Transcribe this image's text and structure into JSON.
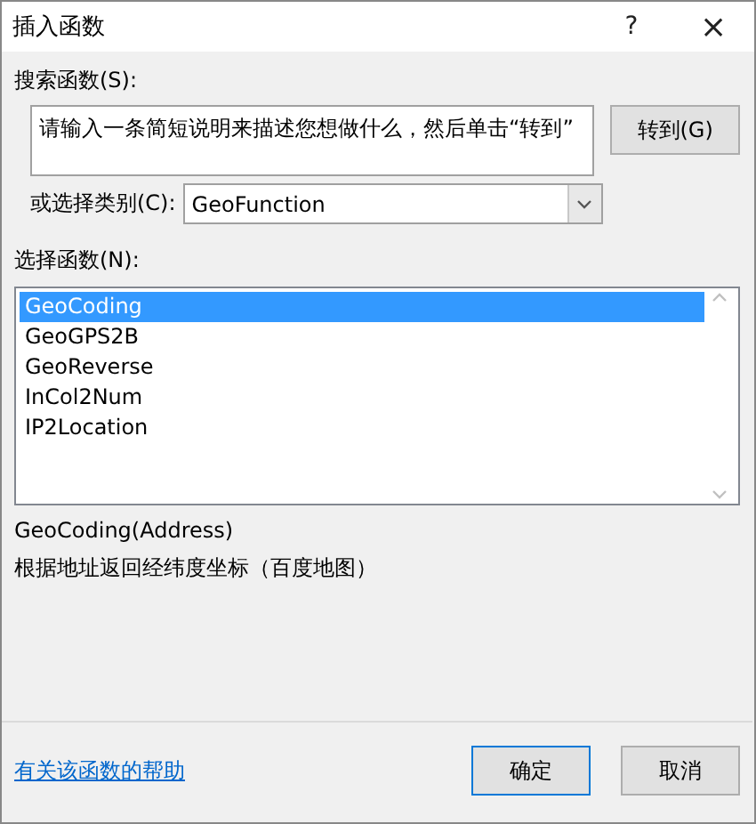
{
  "window": {
    "title": "插入函数",
    "help_button": "?",
    "close_button": "×"
  },
  "search": {
    "label": "搜索函数(S):",
    "placeholder": "请输入一条简短说明来描述您想做什么，然后单击“转到”",
    "go_button": "转到(G)"
  },
  "category": {
    "label": "或选择类别(C):",
    "value": "GeoFunction"
  },
  "functions": {
    "label": "选择函数(N):",
    "items": [
      {
        "name": "GeoCoding",
        "selected": true
      },
      {
        "name": "GeoGPS2B",
        "selected": false
      },
      {
        "name": "GeoReverse",
        "selected": false
      },
      {
        "name": "InCol2Num",
        "selected": false
      },
      {
        "name": "IP2Location",
        "selected": false
      }
    ]
  },
  "signature": "GeoCoding(Address)",
  "description": "根据地址返回经纬度坐标（百度地图）",
  "help_link": "有关该函数的帮助",
  "buttons": [
    {
      "label": "确定",
      "default": true
    },
    {
      "label": "取消",
      "default": false
    }
  ]
}
